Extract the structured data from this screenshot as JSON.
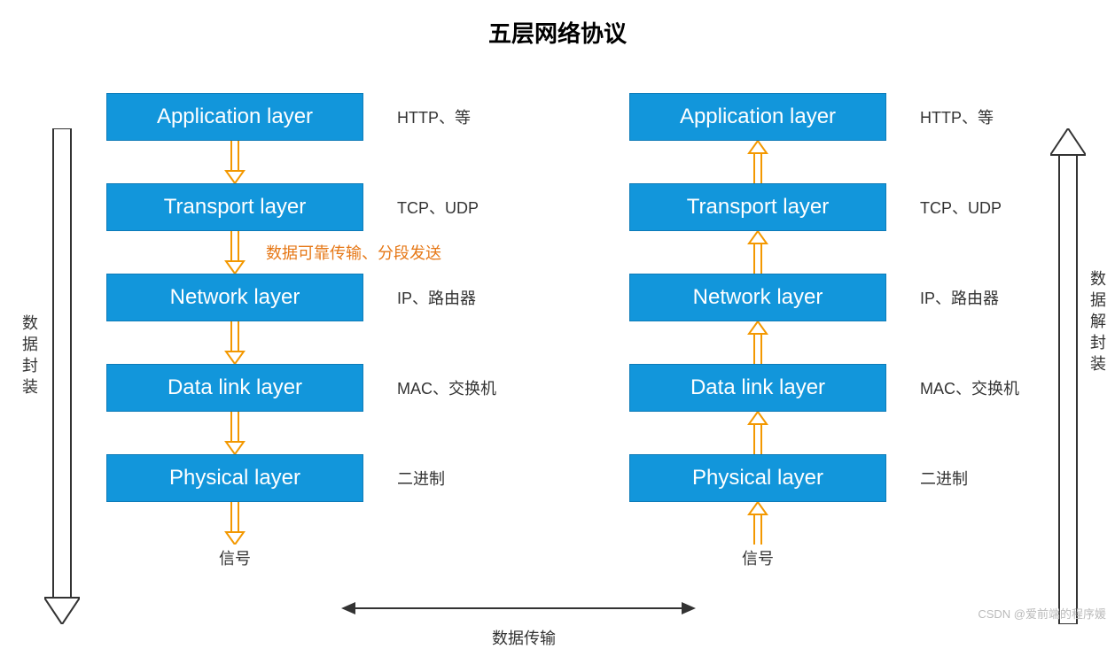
{
  "title": "五层网络协议",
  "left_label": "数据封装",
  "right_label": "数据解封装",
  "bottom_label": "数据传输",
  "signal_label": "信号",
  "watermark": "CSDN @爱前端的程序媛",
  "left_column": {
    "direction": "down",
    "layers": [
      {
        "name": "Application layer",
        "note": "HTTP、等",
        "annotation": ""
      },
      {
        "name": "Transport layer",
        "note": "TCP、UDP",
        "annotation": "数据可靠传输、分段发送"
      },
      {
        "name": "Network layer",
        "note": "IP、路由器",
        "annotation": ""
      },
      {
        "name": "Data link layer",
        "note": "MAC、交换机",
        "annotation": ""
      },
      {
        "name": "Physical layer",
        "note": "二进制",
        "annotation": ""
      }
    ]
  },
  "right_column": {
    "direction": "up",
    "layers": [
      {
        "name": "Application layer",
        "note": "HTTP、等"
      },
      {
        "name": "Transport layer",
        "note": "TCP、UDP"
      },
      {
        "name": "Network layer",
        "note": "IP、路由器"
      },
      {
        "name": "Data link layer",
        "note": "MAC、交换机"
      },
      {
        "name": "Physical layer",
        "note": "二进制"
      }
    ]
  },
  "colors": {
    "box_bg": "#1296db",
    "arrow": "#f39800",
    "annotation": "#e67817"
  }
}
